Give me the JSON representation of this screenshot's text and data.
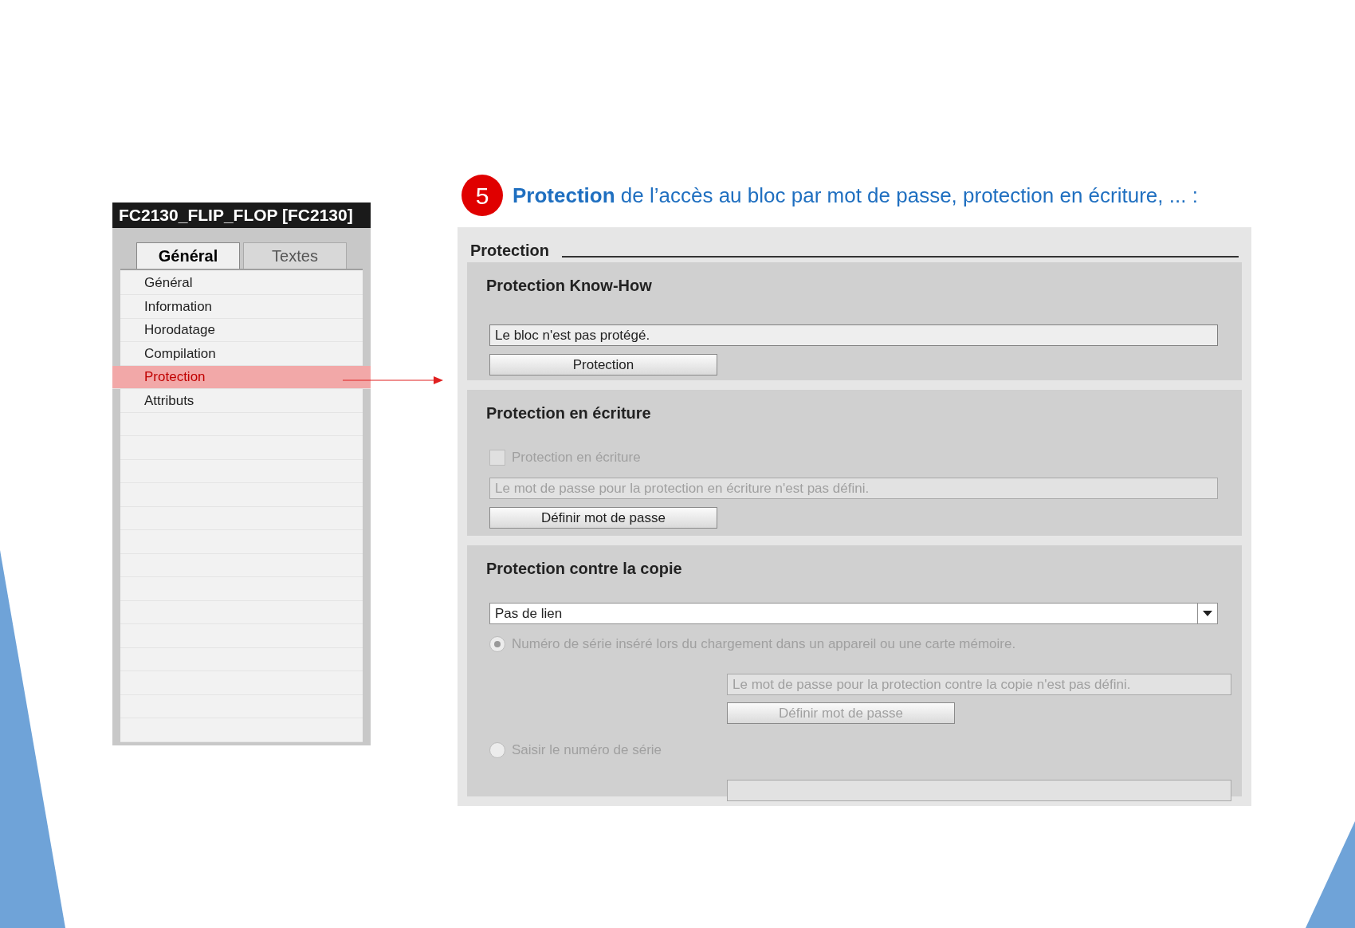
{
  "sidebar_panel": {
    "title": "FC2130_FLIP_FLOP [FC2130]",
    "tabs": [
      {
        "label": "Général",
        "selected": true
      },
      {
        "label": "Textes",
        "selected": false
      }
    ],
    "items": [
      {
        "label": "Général",
        "selected": false
      },
      {
        "label": "Information",
        "selected": false
      },
      {
        "label": "Horodatage",
        "selected": false
      },
      {
        "label": "Compilation",
        "selected": false
      },
      {
        "label": "Protection",
        "selected": true
      },
      {
        "label": "Attributs",
        "selected": false
      }
    ]
  },
  "heading": {
    "number": "5",
    "text": "**Protection** de l’accès au bloc par mot de passe, protection en écriture, ... :"
  },
  "protection_panel": {
    "title": "Protection",
    "sections": [
      {
        "title": "Protection Know-How",
        "controls": [
          {
            "kind": "field",
            "value": "Le bloc n'est pas protégé.",
            "disabled": false
          },
          {
            "kind": "button",
            "label": "Protection",
            "disabled": false
          }
        ]
      },
      {
        "title": "Protection en écriture",
        "controls": [
          {
            "kind": "checkbox",
            "label": "Protection en écriture",
            "checked": false,
            "disabled": true
          },
          {
            "kind": "field",
            "value": "Le mot de passe pour la protection en écriture n'est pas défini.",
            "disabled": true
          },
          {
            "kind": "button",
            "label": "Définir mot de passe",
            "disabled": false
          }
        ]
      },
      {
        "title": "Protection contre la copie",
        "controls": [
          {
            "kind": "dropdown",
            "value": "Pas de lien",
            "disabled": false
          },
          {
            "kind": "radio",
            "label": "Numéro de série inséré lors du chargement dans un appareil ou une carte mémoire.",
            "selected": true,
            "disabled": true,
            "children": [
              {
                "kind": "field",
                "value": "Le mot de passe pour la protection contre la copie n'est pas défini.",
                "disabled": true
              },
              {
                "kind": "button",
                "label": "Définir mot de passe",
                "disabled": true
              }
            ]
          },
          {
            "kind": "radio",
            "label": "Saisir le numéro de série",
            "selected": false,
            "disabled": true,
            "children": [
              {
                "kind": "field",
                "disabled": true
              }
            ]
          }
        ]
      }
    ]
  }
}
